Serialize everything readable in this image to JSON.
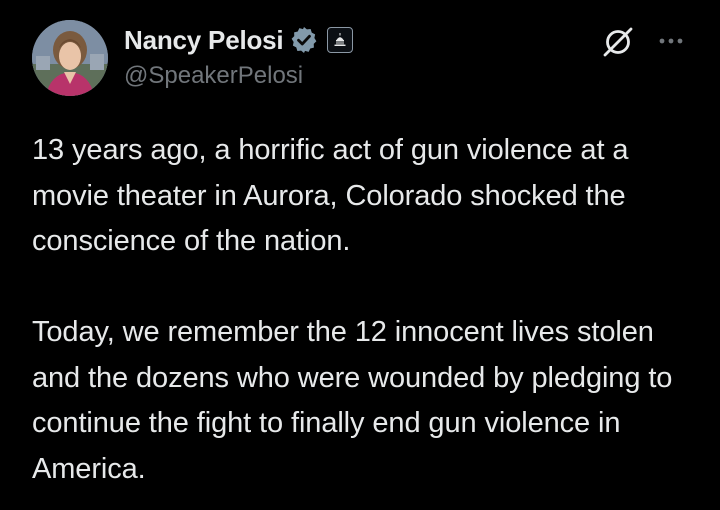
{
  "author": {
    "display_name": "Nancy Pelosi",
    "handle": "@SpeakerPelosi",
    "verified_badge": "verified-icon",
    "affiliation_badge": "capitol-dome-icon"
  },
  "actions": {
    "grok_icon": "grok-icon",
    "more_icon": "more-options-icon"
  },
  "tweet": {
    "paragraphs": [
      "13 years ago, a horrific act of gun violence at a movie theater in Aurora, Colorado shocked the conscience of the nation.",
      "Today, we remember the 12 innocent lives stolen and the dozens who were wounded by pledging to continue the fight to finally end gun violence in America."
    ]
  },
  "colors": {
    "background": "#000000",
    "text_primary": "#e7e9ea",
    "text_secondary": "#71767b",
    "verified_badge": "#829aab"
  }
}
